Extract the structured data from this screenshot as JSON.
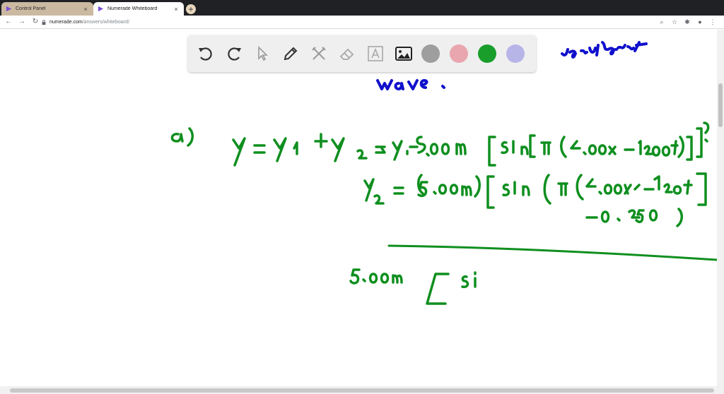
{
  "browser": {
    "tabs": [
      {
        "title": "Control Panel",
        "active": false
      },
      {
        "title": "Numerade Whiteboard",
        "active": true
      }
    ],
    "new_tab_icon": "plus-icon",
    "address": {
      "host": "numerade.com",
      "path": "/answers/whiteboard/"
    }
  },
  "whiteboard": {
    "tools": [
      "undo-icon",
      "redo-icon",
      "pointer-icon",
      "pen-icon",
      "tools-icon",
      "eraser-icon",
      "text-icon",
      "image-icon"
    ],
    "colors": [
      "#9e9e9e",
      "#e9a6ae",
      "#1a9e2b",
      "#b7b4e8"
    ],
    "ink_colors": {
      "blue": "#1010cc",
      "green": "#0f8f1f"
    },
    "notes": {
      "top_right": "resultant",
      "top_left": "wave.",
      "part": "a)",
      "line1_a": "y = y₁ + y₂ =>",
      "line1_b": "y₁=5.00m [Sin[π (4.00x - 1200t)]]",
      "line2": "y₂ = (5.00m) [Sin (π (4.00x - 1200t",
      "line3": "- 0.250)",
      "line4": "5.00m [ Si"
    }
  }
}
